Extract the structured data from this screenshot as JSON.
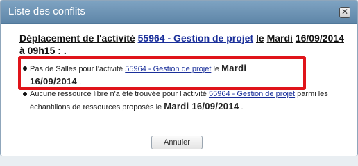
{
  "dialog": {
    "title": "Liste des conflits",
    "close_symbol": "✕"
  },
  "heading": {
    "prefix": "Déplacement de l'activité",
    "activity_link": "55964 - Gestion de projet",
    "le": "le",
    "day": "Mardi",
    "date_time": "16/09/2014 à 09h15 :",
    "trail": "."
  },
  "conflicts": [
    {
      "text_before": "Pas de Salles pour l'activité",
      "link": "55964 - Gestion de projet",
      "text_after": "le",
      "date": "Mardi 16/09/2014",
      "end": "."
    },
    {
      "text_before": "Aucune ressource libre n'a été trouvée pour l'activité",
      "link": "55964 - Gestion de projet",
      "text_after": "parmi les échantillons de ressources proposés le",
      "date": "Mardi 16/09/2014",
      "end": "."
    }
  ],
  "buttons": {
    "cancel": "Annuler"
  },
  "colors": {
    "titlebar": "#6f95b6",
    "highlight_border": "#e0141a",
    "link": "#1a2f9a"
  },
  "icons": {
    "close": "close-icon"
  }
}
